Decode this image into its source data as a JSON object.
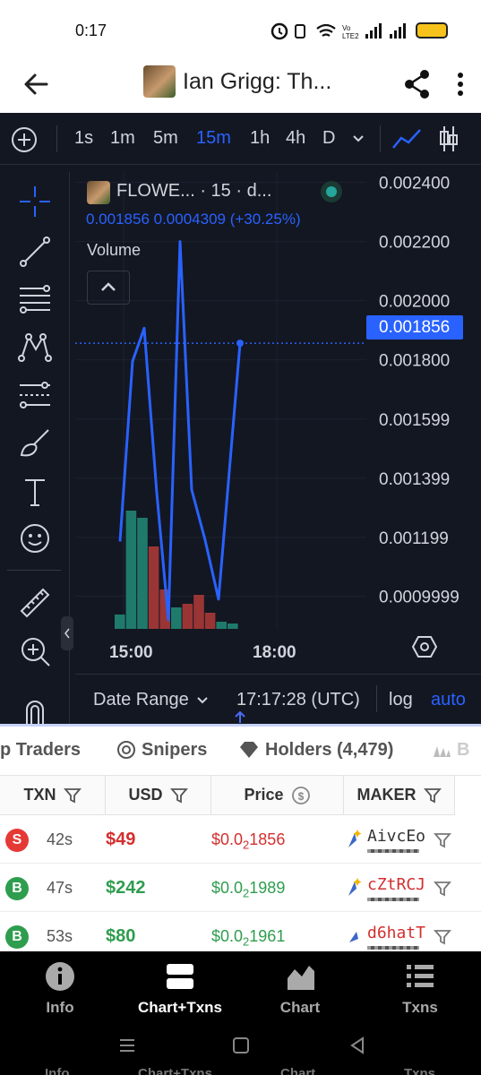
{
  "status_bar": {
    "time": "0:17"
  },
  "header": {
    "title": "Ian Grigg: Th..."
  },
  "toolbar": {
    "timeframes": [
      {
        "label": "1s",
        "active": false
      },
      {
        "label": "1m",
        "active": false
      },
      {
        "label": "5m",
        "active": false
      },
      {
        "label": "15m",
        "active": true
      },
      {
        "label": "1h",
        "active": false
      },
      {
        "label": "4h",
        "active": false
      },
      {
        "label": "D",
        "active": false
      }
    ]
  },
  "chart": {
    "symbol": "FLOWE... · 15 · d...",
    "legend_values": "0.001856  0.0004309 (+30.25%)",
    "volume_label": "Volume",
    "current_price_label": "0.001856",
    "accent": "#2962ff",
    "up_color": "#26a69a",
    "down_color": "#ef5350",
    "date_range_label": "Date Range",
    "clock": "17:17:28 (UTC)",
    "log_label": "log",
    "auto_label": "auto"
  },
  "chart_data": {
    "type": "line",
    "y_tick_labels": [
      "0.002400",
      "0.002200",
      "0.002000",
      "0.001800",
      "0.001599",
      "0.001399",
      "0.001199",
      "0.0009999"
    ],
    "x_tick_labels": [
      "15:00",
      "18:00"
    ],
    "ylim": [
      0.00092,
      0.00242
    ],
    "series": [
      {
        "x": [
          0,
          1,
          2,
          3,
          4,
          5,
          6,
          7,
          8,
          9
        ],
        "values": [
          0.001185,
          0.001795,
          0.001907,
          0.00135,
          0.00092,
          0.0022,
          0.00136,
          0.00119,
          0.00099,
          0.001856
        ]
      }
    ],
    "volume": [
      {
        "value": 0.08,
        "dir": "up"
      },
      {
        "value": 0.66,
        "dir": "up"
      },
      {
        "value": 0.62,
        "dir": "up"
      },
      {
        "value": 0.46,
        "dir": "down"
      },
      {
        "value": 0.22,
        "dir": "down"
      },
      {
        "value": 0.12,
        "dir": "up"
      },
      {
        "value": 0.14,
        "dir": "down"
      },
      {
        "value": 0.19,
        "dir": "down"
      },
      {
        "value": 0.09,
        "dir": "down"
      },
      {
        "value": 0.04,
        "dir": "up"
      },
      {
        "value": 0.03,
        "dir": "up"
      }
    ]
  },
  "tabs": [
    {
      "label": "p Traders"
    },
    {
      "label": "Snipers"
    },
    {
      "label": "Holders (4,479)"
    },
    {
      "label": "B"
    }
  ],
  "table": {
    "headers": [
      "TXN",
      "USD",
      "Price",
      "MAKER"
    ],
    "rows": [
      {
        "type": "S",
        "age": "42s",
        "usd": "$49",
        "price": "$0.0",
        "zeros": "2",
        "price_rest": "1856",
        "maker": "AivcEo",
        "color": "#d32f2f"
      },
      {
        "type": "B",
        "age": "47s",
        "usd": "$242",
        "price": "$0.0",
        "zeros": "2",
        "price_rest": "1989",
        "maker": "cZtRCJ",
        "color": "#2e9d4e"
      },
      {
        "type": "B",
        "age": "53s",
        "usd": "$80",
        "price": "$0.0",
        "zeros": "2",
        "price_rest": "1961",
        "maker": "d6hatT",
        "color": "#2e9d4e"
      }
    ]
  },
  "bottom_nav": {
    "items": [
      {
        "label": "Info",
        "icon": "info-icon",
        "active": false
      },
      {
        "label": "Chart+Txns",
        "icon": "split-view-icon",
        "active": true
      },
      {
        "label": "Chart",
        "icon": "area-chart-icon",
        "active": false
      },
      {
        "label": "Txns",
        "icon": "list-icon",
        "active": false
      }
    ]
  }
}
